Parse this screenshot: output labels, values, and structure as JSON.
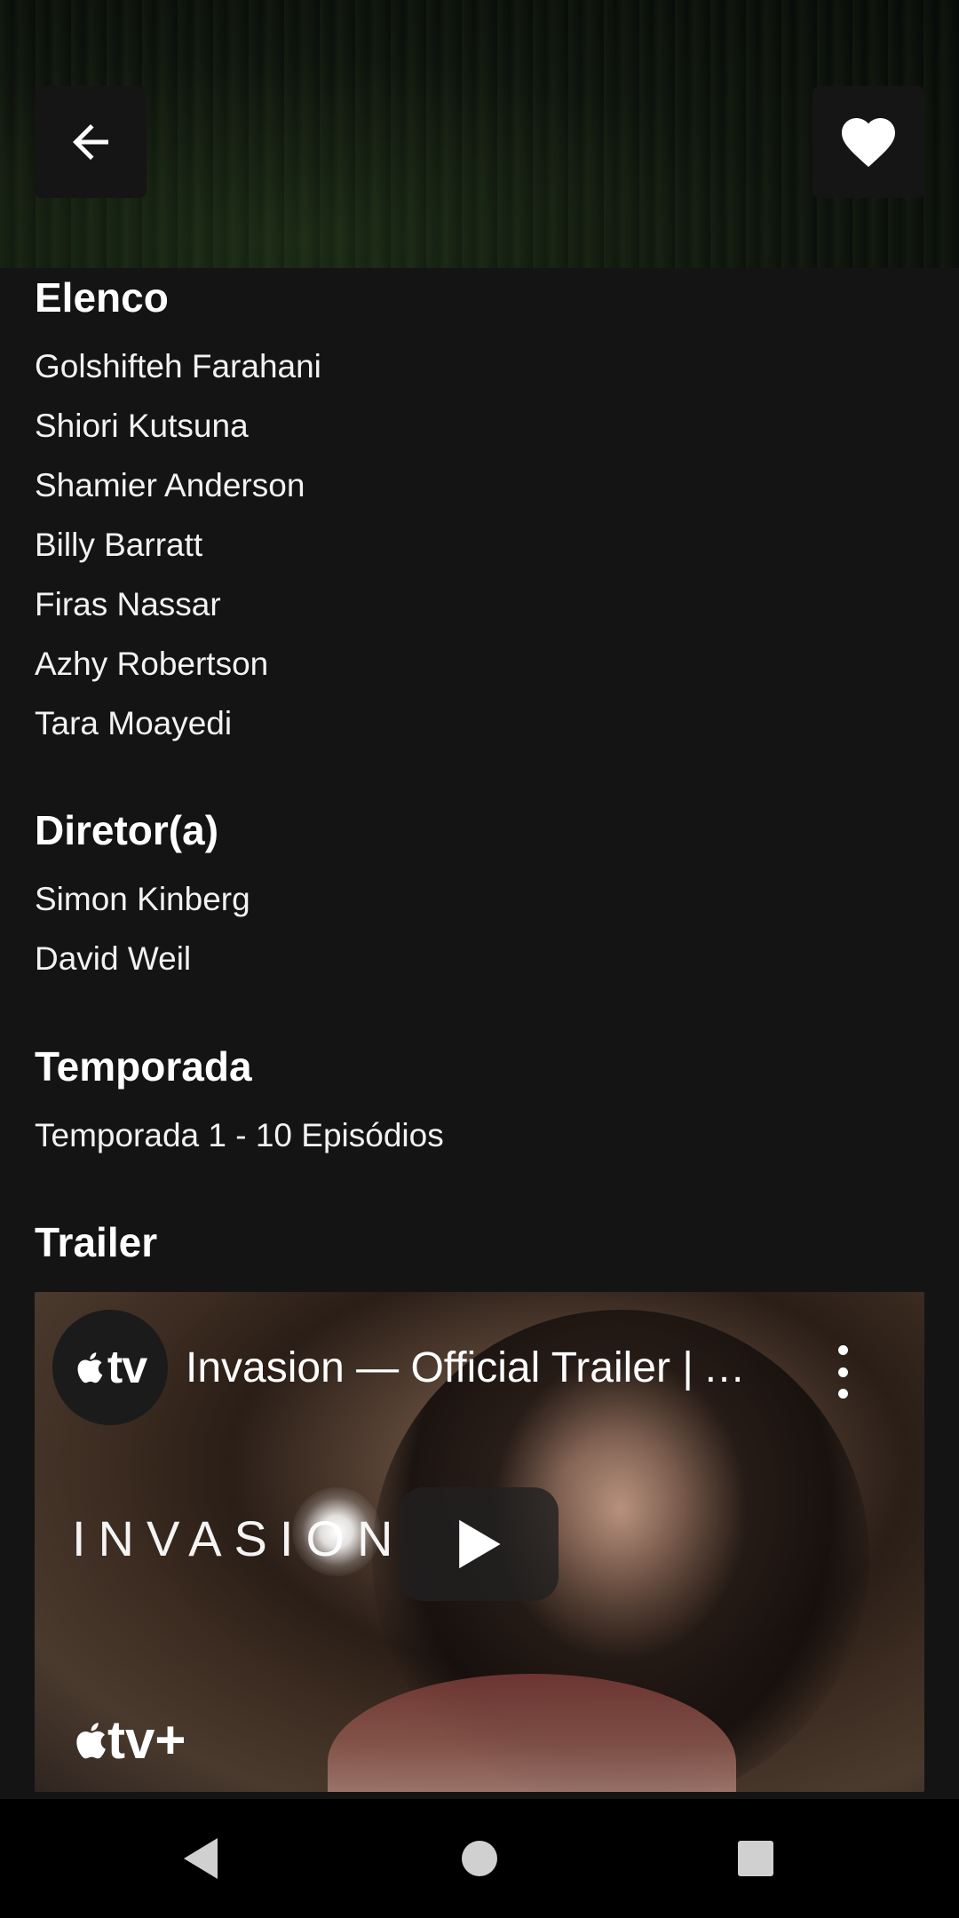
{
  "cast": {
    "title": "Elenco",
    "items": [
      "Golshifteh Farahani",
      "Shiori Kutsuna",
      "Shamier Anderson",
      "Billy Barratt",
      "Firas Nassar",
      "Azhy Robertson",
      "Tara Moayedi"
    ]
  },
  "director": {
    "title": "Diretor(a)",
    "items": [
      "Simon Kinberg",
      "David Weil"
    ]
  },
  "season": {
    "title": "Temporada",
    "items": [
      "Temporada 1 - 10 Episódios"
    ]
  },
  "trailer": {
    "title": "Trailer",
    "channel_label": "tv",
    "video_title": "Invasion — Official Trailer | A...",
    "wordmark": "INVASION",
    "brand": "tv+"
  },
  "icons": {
    "back": "arrow-left-icon",
    "favorite": "heart-icon",
    "play": "play-icon",
    "more": "more-vert-icon"
  },
  "colors": {
    "background": "#141414",
    "text": "#ffffff",
    "button_bg": "#151515"
  }
}
